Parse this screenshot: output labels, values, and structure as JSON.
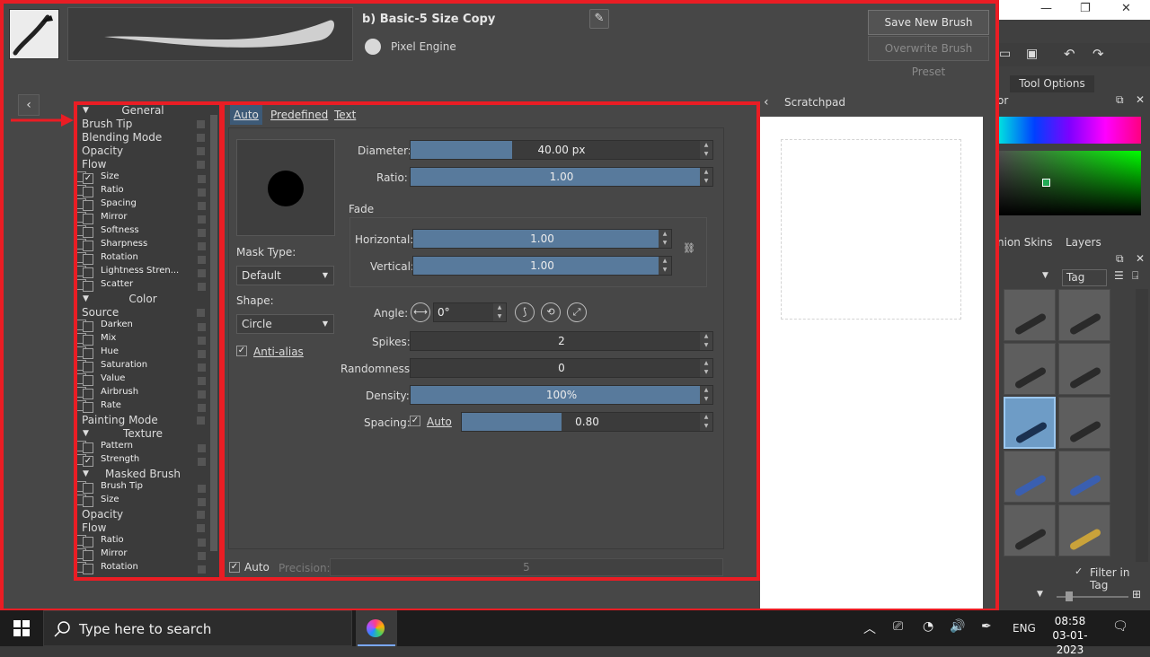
{
  "preset": {
    "name": "b) Basic-5 Size Copy",
    "engine": "Pixel Engine",
    "save_label": "Save New Brush Preset...",
    "overwrite_label": "Overwrite Brush Preset"
  },
  "options": [
    {
      "type": "hdr",
      "label": "General"
    },
    {
      "type": "plain",
      "label": "Brush Tip"
    },
    {
      "type": "plain",
      "label": "Blending Mode"
    },
    {
      "type": "plain",
      "label": "Opacity"
    },
    {
      "type": "plain",
      "label": "Flow"
    },
    {
      "type": "check",
      "label": "Size",
      "checked": true
    },
    {
      "type": "check",
      "label": "Ratio",
      "checked": false
    },
    {
      "type": "check",
      "label": "Spacing",
      "checked": false
    },
    {
      "type": "check",
      "label": "Mirror",
      "checked": false
    },
    {
      "type": "check",
      "label": "Softness",
      "checked": false
    },
    {
      "type": "check",
      "label": "Sharpness",
      "checked": false
    },
    {
      "type": "check",
      "label": "Rotation",
      "checked": false
    },
    {
      "type": "check",
      "label": "Lightness Stren...",
      "checked": false
    },
    {
      "type": "check",
      "label": "Scatter",
      "checked": false
    },
    {
      "type": "hdr",
      "label": "Color"
    },
    {
      "type": "plain",
      "label": "Source"
    },
    {
      "type": "check",
      "label": "Darken",
      "checked": false
    },
    {
      "type": "check",
      "label": "Mix",
      "checked": false
    },
    {
      "type": "check",
      "label": "Hue",
      "checked": false
    },
    {
      "type": "check",
      "label": "Saturation",
      "checked": false
    },
    {
      "type": "check",
      "label": "Value",
      "checked": false
    },
    {
      "type": "check",
      "label": "Airbrush",
      "checked": false
    },
    {
      "type": "check",
      "label": "Rate",
      "checked": false
    },
    {
      "type": "plain",
      "label": "Painting Mode"
    },
    {
      "type": "hdr",
      "label": "Texture"
    },
    {
      "type": "check",
      "label": "Pattern",
      "checked": false
    },
    {
      "type": "check",
      "label": "Strength",
      "checked": true
    },
    {
      "type": "hdr",
      "label": "Masked Brush"
    },
    {
      "type": "check",
      "label": "Brush Tip",
      "checked": false
    },
    {
      "type": "check",
      "label": "Size",
      "checked": false
    },
    {
      "type": "plain",
      "label": "Opacity"
    },
    {
      "type": "plain",
      "label": "Flow"
    },
    {
      "type": "check",
      "label": "Ratio",
      "checked": false
    },
    {
      "type": "check",
      "label": "Mirror",
      "checked": false
    },
    {
      "type": "check",
      "label": "Rotation",
      "checked": false
    }
  ],
  "tabs": [
    "Auto",
    "Predefined",
    "Text"
  ],
  "tip": {
    "mask_type_label": "Mask Type:",
    "mask_type": "Default",
    "shape_label": "Shape:",
    "shape": "Circle",
    "antialias_label": "Anti-alias",
    "diameter_label": "Diameter:",
    "diameter": "40.00 px",
    "diameter_fill": 0.35,
    "ratio_label": "Ratio:",
    "ratio": "1.00",
    "ratio_fill": 1.0,
    "fade_label": "Fade",
    "horizontal_label": "Horizontal:",
    "horizontal": "1.00",
    "horizontal_fill": 1.0,
    "vertical_label": "Vertical:",
    "vertical": "1.00",
    "vertical_fill": 1.0,
    "angle_label": "Angle:",
    "angle": "0°",
    "spikes_label": "Spikes:",
    "spikes": "2",
    "randomness_label": "Randomness:",
    "randomness": "0",
    "density_label": "Density:",
    "density": "100%",
    "density_fill": 1.0,
    "spacing_label": "Spacing:",
    "spacing_auto": "Auto",
    "spacing": "0.80",
    "spacing_fill": 0.42
  },
  "precision": {
    "auto": "Auto",
    "label": "Precision:",
    "value": "5"
  },
  "scratchpad": {
    "title": "Scratchpad"
  },
  "rightpanel": {
    "tool_options": "Tool Options",
    "color_title": "or",
    "onion": "nion Skins",
    "layers": "Layers",
    "tag": "Tag",
    "filter": "Filter in Tag"
  },
  "taskbar": {
    "search_placeholder": "Type here to search",
    "lang": "ENG",
    "time": "08:58",
    "date": "03-01-2023"
  }
}
